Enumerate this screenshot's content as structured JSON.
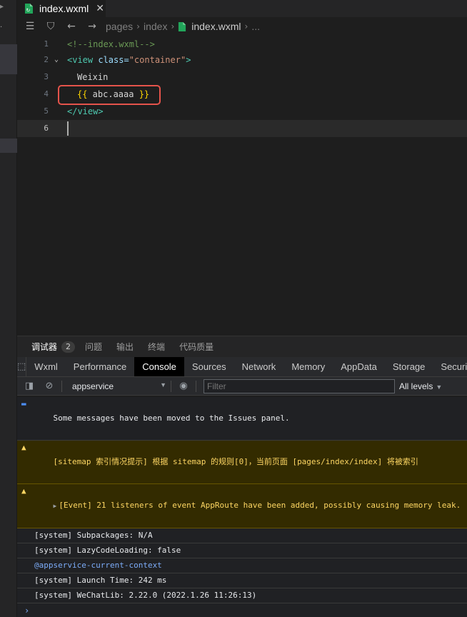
{
  "editor_tab": {
    "filename": "index.wxml",
    "close_glyph": "✕"
  },
  "breadcrumb": {
    "items": [
      "pages",
      "index",
      "index.wxml",
      "..."
    ]
  },
  "editor": {
    "lines": [
      {
        "num": "1",
        "comment": "<!--index.wxml-->"
      },
      {
        "num": "2",
        "tag_open": "<view",
        "attr": " class=",
        "value": "\"container\"",
        "tag_close": ">"
      },
      {
        "num": "3",
        "text": "Weixin"
      },
      {
        "num": "4",
        "brace_open": "{{",
        "expr": " abc.aaaa ",
        "brace_close": "}}"
      },
      {
        "num": "5",
        "tag": "</view>"
      },
      {
        "num": "6"
      }
    ]
  },
  "debug_tabs": [
    {
      "label": "调试器",
      "badge": "2"
    },
    {
      "label": "问题"
    },
    {
      "label": "输出"
    },
    {
      "label": "终端"
    },
    {
      "label": "代码质量"
    }
  ],
  "devtools_tabs": [
    "Wxml",
    "Performance",
    "Console",
    "Sources",
    "Network",
    "Memory",
    "AppData",
    "Storage",
    "Securi"
  ],
  "console_toolbar": {
    "context": "appservice",
    "filter_placeholder": "Filter",
    "levels": "All levels"
  },
  "console_messages": [
    "Some messages have been moved to the Issues panel.",
    "[sitemap 索引情况提示] 根据 sitemap 的规则[0]，当前页面 [pages/index/index] 将被索引",
    "[Event] 21 listeners of event AppRoute have been added, possibly causing memory leak.",
    "[system] Subpackages: N/A",
    "[system] LazyCodeLoading: false",
    "@appservice-current-context",
    "[system] Launch Time: 242 ms",
    "[system] WeChatLib: 2.22.0 (2022.1.26 11:26:13)"
  ],
  "prompt_glyph": "›",
  "colors": {
    "highlight_box": "#e5534b",
    "warning_bg": "#332b00",
    "warning_text": "#fdd663",
    "active_tab_bg": "#000000"
  }
}
